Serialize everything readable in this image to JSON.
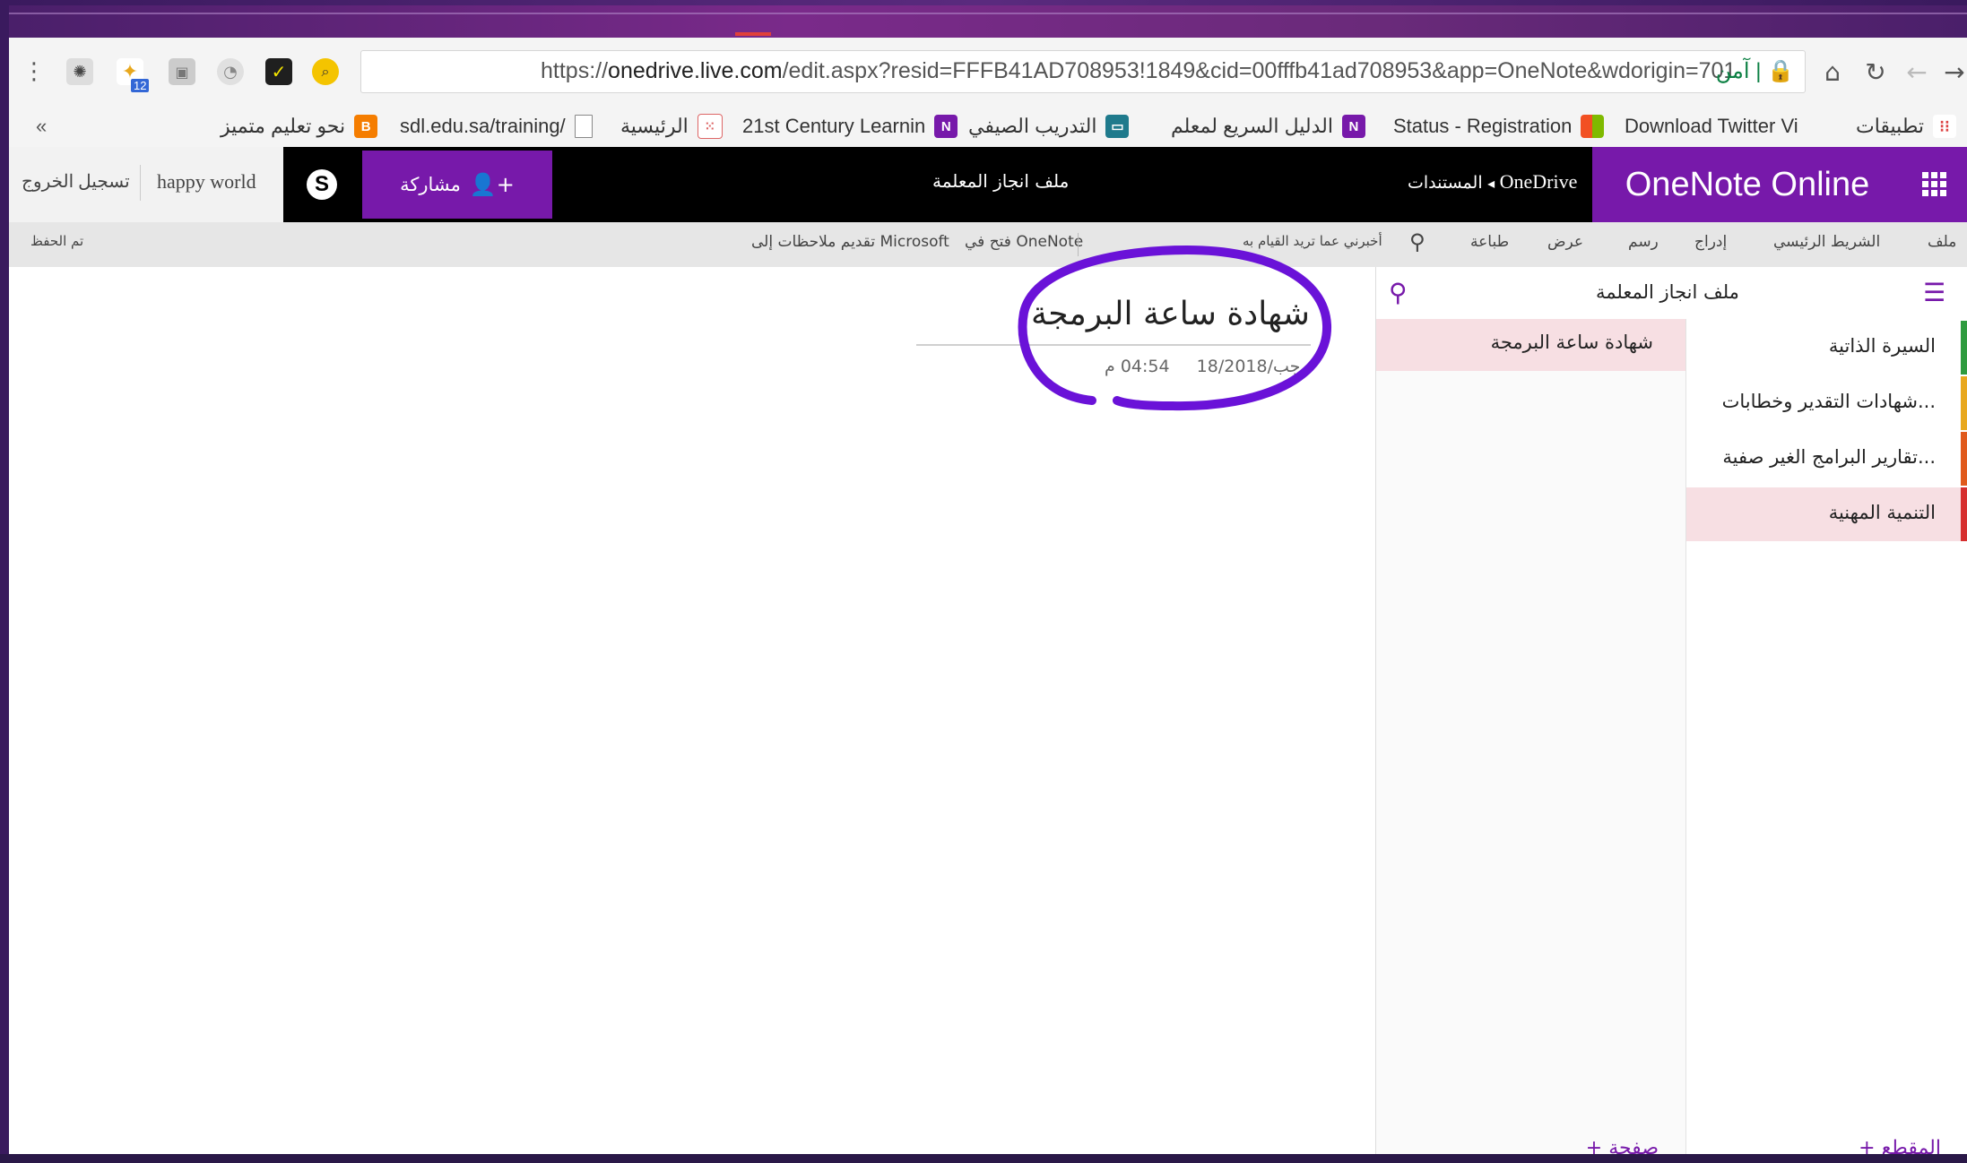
{
  "browser": {
    "url_prefix": "https://",
    "url_host": "onedrive.live.com",
    "url_rest": "/edit.aspx?resid=FFFB41AD708953!1849&cid=00fffb41ad708953&app=OneNote&wdorigin=701",
    "secure_label": "آمن",
    "ext_badge": "12",
    "more_bookmarks": "«"
  },
  "bookmarks": [
    {
      "label": "نحو تعليم متميز",
      "icon": "blogger-icon"
    },
    {
      "label": "sdl.edu.sa/training/",
      "icon": "page-icon"
    },
    {
      "label": "الرئيسية",
      "icon": "dots-icon"
    },
    {
      "label": "21st Century Learnin",
      "icon": "onenote-icon"
    },
    {
      "label": "التدريب الصيفي",
      "icon": "edu-icon"
    },
    {
      "label": "الدليل السريع لمعلم",
      "icon": "onenote-icon"
    },
    {
      "label": "Status - Registration",
      "icon": "windows-icon"
    },
    {
      "label": "Download Twitter Vi",
      "icon": "none"
    },
    {
      "label": "تطبيقات",
      "icon": "apps-icon"
    }
  ],
  "header": {
    "brand": "OneNote Online",
    "breadcrumb_root": "OneDrive",
    "breadcrumb_sep": "◂",
    "breadcrumb_folder": "المستندات",
    "document_title": "ملف انجاز المعلمة",
    "share_label": "مشاركة",
    "user_name": "happy world",
    "sign_out": "تسجيل الخروج"
  },
  "ribbon": {
    "tabs": [
      "ملف",
      "الشريط الرئيسي",
      "إدراج",
      "رسم",
      "عرض",
      "طباعة"
    ],
    "tell_me": "أخبرني عما تريد القيام به",
    "open_in_onenote": "فتح في OneNote",
    "feedback": "تقديم ملاحظات إلى Microsoft",
    "saved": "تم الحفظ"
  },
  "notebook": {
    "title": "ملف انجاز المعلمة",
    "sections": [
      {
        "label": "السيرة الذاتية",
        "color": "#2e9b3f"
      },
      {
        "label": "شهادات التقدير وخطابات...",
        "color": "#e8a81e"
      },
      {
        "label": "تقارير البرامج الغير صفية...",
        "color": "#e05a1c"
      },
      {
        "label": "التنمية المهنية",
        "color": "#d62f2f"
      }
    ],
    "pages": [
      "شهادة ساعة البرمجة"
    ],
    "add_section": "+ المقطع",
    "add_page": "+ صفحة"
  },
  "page": {
    "title": "شهادة ساعة البرمجة",
    "date": "18/رجب/2018",
    "time": "04:54 م"
  },
  "colors": {
    "accent": "#7719aa",
    "annotation": "#6a12d8",
    "selected_bg": "#f7dfe3"
  }
}
